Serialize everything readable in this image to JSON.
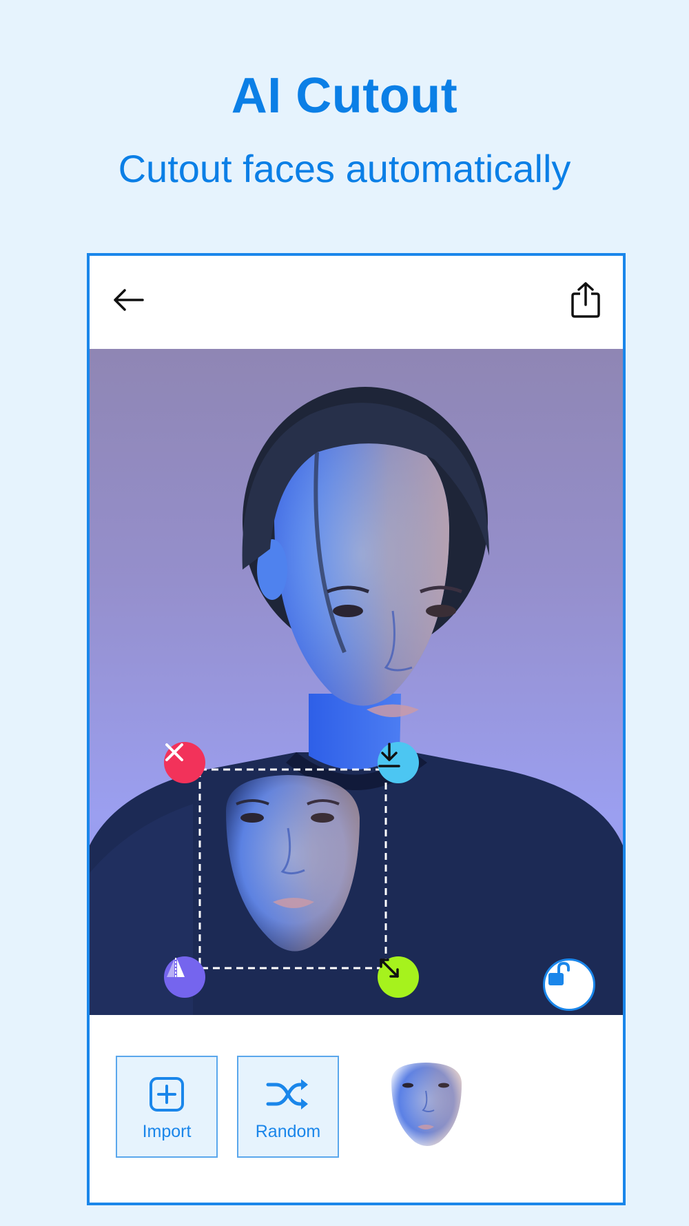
{
  "header": {
    "title": "AI Cutout",
    "subtitle": "Cutout faces automatically"
  },
  "topbar": {
    "back_icon": "arrow-left-icon",
    "share_icon": "share-icon"
  },
  "canvas": {
    "handles": {
      "delete_icon": "close-icon",
      "download_icon": "download-icon",
      "flip_icon": "flip-icon",
      "resize_icon": "resize-diagonal-icon"
    },
    "lock_icon": "unlock-icon"
  },
  "toolbar": {
    "import_label": "Import",
    "random_label": "Random",
    "import_icon": "plus-square-icon",
    "random_icon": "shuffle-icon"
  },
  "colors": {
    "brand": "#0b7fe6",
    "frame": "#1a86ea",
    "page_bg": "#e6f3fd",
    "delete_handle": "#f2325a",
    "download_handle": "#4cc6f2",
    "flip_handle": "#7565ee",
    "resize_handle": "#a6f21d"
  }
}
